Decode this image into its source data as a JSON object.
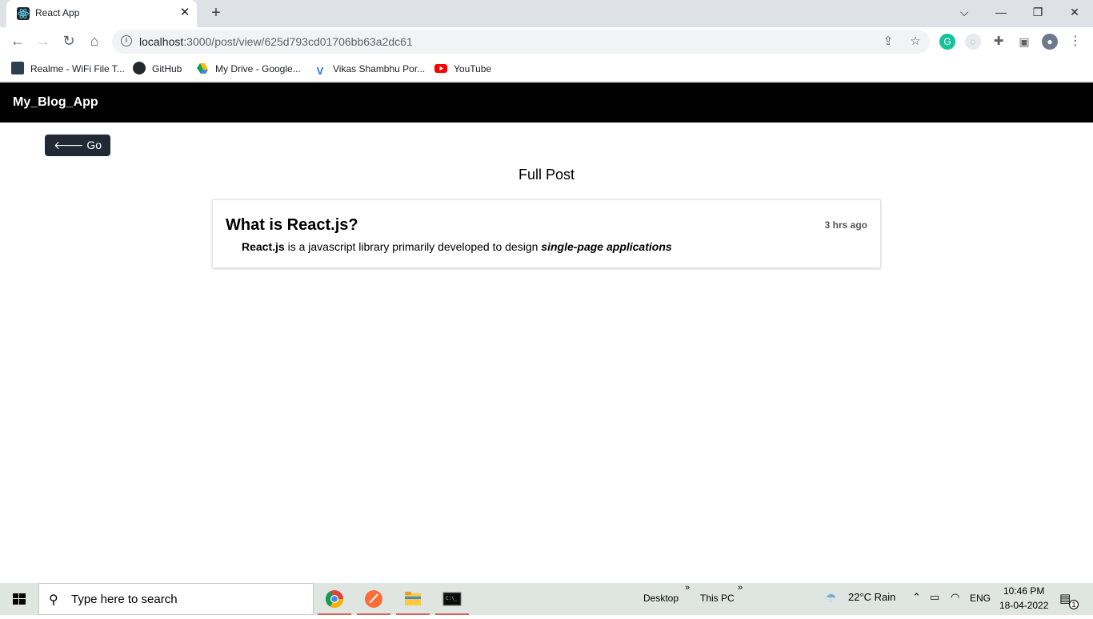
{
  "browser": {
    "tab_title": "React App",
    "tab_close": "✕",
    "new_tab": "+",
    "url_host": "localhost",
    "url_path": ":3000/post/view/625d793cd01706bb63a2dc61",
    "window_controls": {
      "dropdown": "⌵",
      "minimize": "—",
      "restore": "❐",
      "close": "✕"
    },
    "nav": {
      "back": "←",
      "forward": "→",
      "reload": "↻",
      "home": "⌂"
    }
  },
  "bookmarks": [
    {
      "label": "Realme - WiFi File T...",
      "icon": "wifi-file-icon",
      "color": "#2c3e50"
    },
    {
      "label": "GitHub",
      "icon": "github-icon",
      "color": "#24292e"
    },
    {
      "label": "My Drive - Google...",
      "icon": "google-drive-icon",
      "color": "#fbbc04"
    },
    {
      "label": "Vikas Shambhu Por...",
      "icon": "v-logo-icon",
      "color": "#1a73e8"
    },
    {
      "label": "YouTube",
      "icon": "youtube-icon",
      "color": "#ff0000"
    }
  ],
  "app": {
    "brand": "My_Blog_App",
    "go_back_label": "Go Back",
    "page_title": "Full Post",
    "post": {
      "title": "What is React.js?",
      "time": "3 hrs ago",
      "body_strong": "React.js",
      "body_text": " is a javascript library primarily developed to design ",
      "body_emphasis": "single-page applications"
    }
  },
  "taskbar": {
    "search_placeholder": "Type here to search",
    "desktop_label": "Desktop",
    "thispc_label": "This PC",
    "chevron": "»",
    "weather": "22°C  Rain",
    "language": "ENG",
    "time": "10:46 PM",
    "date": "18-04-2022",
    "notification_count": "1"
  },
  "colors": {
    "navbar": "#000000",
    "button": "#212934",
    "taskbar": "#dfe6e2"
  }
}
